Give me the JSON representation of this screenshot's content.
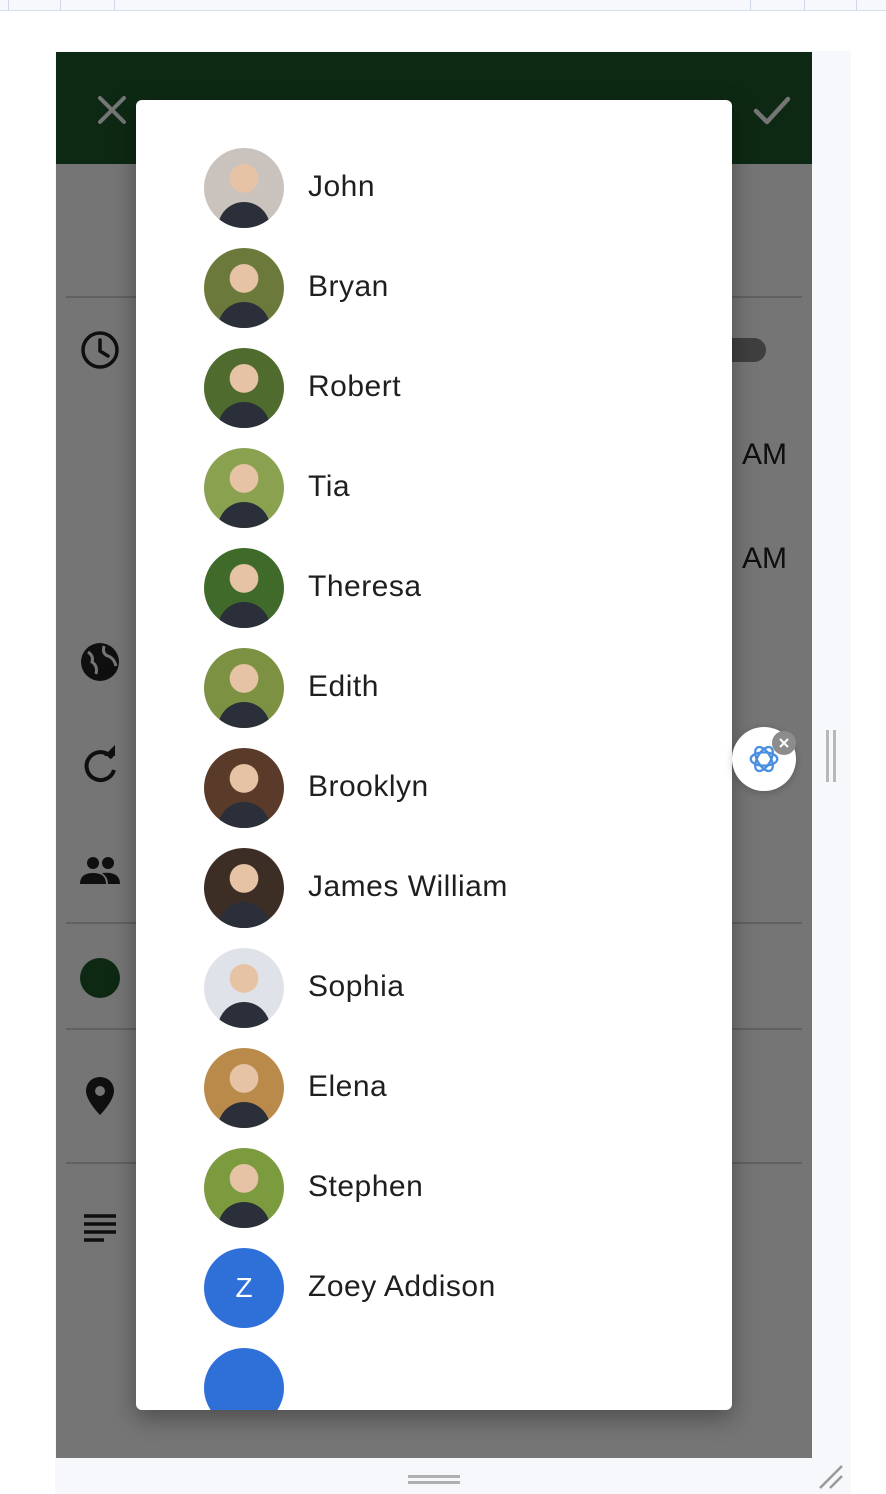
{
  "app": {
    "close_icon": "close-icon",
    "confirm_icon": "check-icon",
    "appbar_color": "#1e5a2a",
    "start_meridiem": "AM",
    "end_meridiem": "AM",
    "event_color": "#1e5a2a",
    "row_icons": [
      "clock-icon",
      "globe-icon",
      "repeat-icon",
      "people-icon",
      "location-icon",
      "notes-icon"
    ]
  },
  "dialog": {
    "people": [
      {
        "name": "John",
        "avatar": "photo",
        "tone": "#c9c2bd"
      },
      {
        "name": "Bryan",
        "avatar": "photo",
        "tone": "#6b7a3a"
      },
      {
        "name": "Robert",
        "avatar": "photo",
        "tone": "#4f6b2e"
      },
      {
        "name": "Tia",
        "avatar": "photo",
        "tone": "#8aa150"
      },
      {
        "name": "Theresa",
        "avatar": "photo",
        "tone": "#3f6a2a"
      },
      {
        "name": "Edith",
        "avatar": "photo",
        "tone": "#7c9142"
      },
      {
        "name": "Brooklyn",
        "avatar": "photo",
        "tone": "#5a3a28"
      },
      {
        "name": "James William",
        "avatar": "photo",
        "tone": "#3c2d25"
      },
      {
        "name": "Sophia",
        "avatar": "photo",
        "tone": "#dfe2e8"
      },
      {
        "name": "Elena",
        "avatar": "photo",
        "tone": "#b98a4a"
      },
      {
        "name": "Stephen",
        "avatar": "photo",
        "tone": "#7c9a3e"
      },
      {
        "name": "Zoey Addison",
        "avatar": "initial",
        "initial": "Z",
        "tone": "#2e6fd8"
      },
      {
        "name": "",
        "avatar": "initial",
        "initial": "",
        "tone": "#2e6fd8"
      }
    ]
  },
  "assistant": {
    "icon": "openai-logo-icon",
    "close_icon": "close-icon"
  }
}
